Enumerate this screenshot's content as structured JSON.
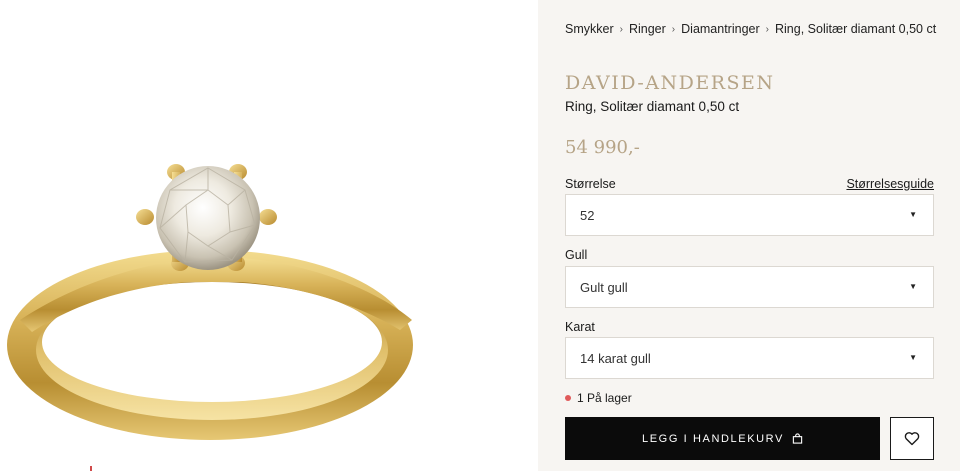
{
  "breadcrumb": {
    "items": [
      "Smykker",
      "Ringer",
      "Diamantringer",
      "Ring, Solitær diamant 0,50 ct"
    ],
    "separator": "›"
  },
  "product": {
    "brand": "DAVID-ANDERSEN",
    "name": "Ring, Solitær diamant 0,50 ct",
    "price": "54 990,-",
    "image_icon": "gold-solitaire-ring"
  },
  "options": {
    "size": {
      "label": "Størrelse",
      "guide_link": "Størrelsesguide",
      "value": "52"
    },
    "gold": {
      "label": "Gull",
      "value": "Gult gull"
    },
    "karat": {
      "label": "Karat",
      "value": "14 karat gull"
    },
    "caret": "▼"
  },
  "stock": {
    "text": "1 På lager",
    "color": "#e05a5a"
  },
  "actions": {
    "add_to_cart": "LEGG I HANDLEKURV",
    "cart_icon": "shopping-bag-icon",
    "wishlist_icon": "heart-icon"
  },
  "colors": {
    "brand": "#b6a487",
    "panel": "#f7f5f2",
    "button": "#0b0b0b",
    "gold": "#d9b65a"
  }
}
